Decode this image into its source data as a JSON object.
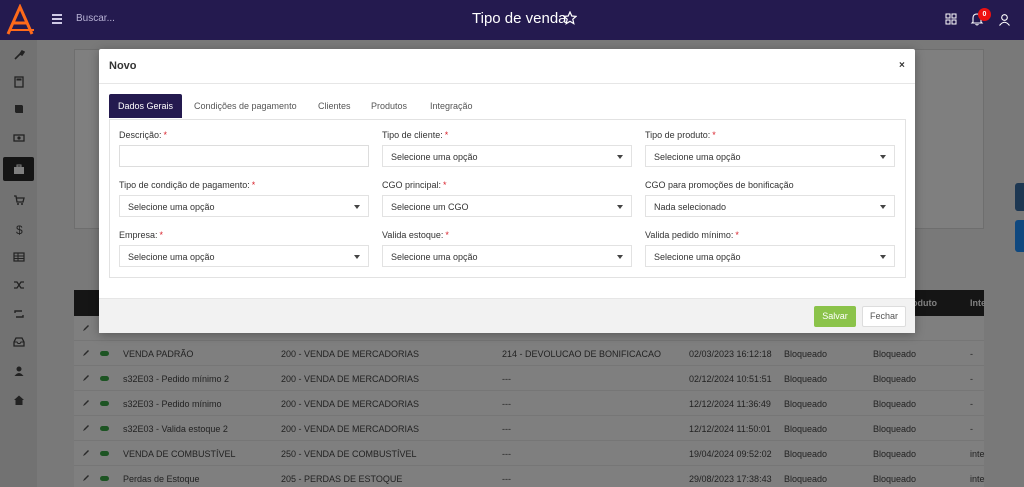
{
  "header": {
    "search_placeholder": "Buscar...",
    "title": "Tipo de venda",
    "notification_count": "0"
  },
  "sidebar": {
    "icons": [
      "wrench-icon",
      "calculator-icon",
      "book-icon",
      "money-icon",
      "briefcase-icon",
      "cart-icon",
      "dollar-icon",
      "table-icon",
      "shuffle-icon",
      "sync-icon",
      "inbox-icon",
      "user-icon",
      "home-icon"
    ]
  },
  "background": {
    "header_cells": [
      "oduto",
      "Inte"
    ],
    "rows": [
      {
        "name": "VENDA PADRÃO",
        "cfop": "200 - VENDA DE MERCADORIAS",
        "bonus": "214 - DEVOLUCAO DE BONIFICACAO",
        "date": "02/03/2023 16:12:18",
        "s1": "Bloqueado",
        "s2": "Bloqueado",
        "s3": "-"
      },
      {
        "name": "s32E03 - Pedido mínimo 2",
        "cfop": "200 - VENDA DE MERCADORIAS",
        "bonus": "---",
        "date": "02/12/2024 10:51:51",
        "s1": "Bloqueado",
        "s2": "Bloqueado",
        "s3": "-"
      },
      {
        "name": "s32E03 - Pedido mínimo",
        "cfop": "200 - VENDA DE MERCADORIAS",
        "bonus": "---",
        "date": "12/12/2024 11:36:49",
        "s1": "Bloqueado",
        "s2": "Bloqueado",
        "s3": "-"
      },
      {
        "name": "s32E03 - Valida estoque 2",
        "cfop": "200 - VENDA DE MERCADORIAS",
        "bonus": "---",
        "date": "12/12/2024 11:50:01",
        "s1": "Bloqueado",
        "s2": "Bloqueado",
        "s3": "-"
      },
      {
        "name": "VENDA DE COMBUSTÍVEL",
        "cfop": "250 - VENDA DE COMBUSTÍVEL",
        "bonus": "---",
        "date": "19/04/2024 09:52:02",
        "s1": "Bloqueado",
        "s2": "Bloqueado",
        "s3": "inte"
      },
      {
        "name": "Perdas de Estoque",
        "cfop": "205 - PERDAS DE ESTOQUE",
        "bonus": "---",
        "date": "29/08/2023 17:38:43",
        "s1": "Bloqueado",
        "s2": "Bloqueado",
        "s3": "inte"
      }
    ]
  },
  "modal": {
    "title": "Novo",
    "close": "×",
    "tabs": [
      "Dados Gerais",
      "Condições de pagamento",
      "Clientes",
      "Produtos",
      "Integração"
    ],
    "fields": {
      "descricao": {
        "label": "Descrição:",
        "value": ""
      },
      "tipo_cliente": {
        "label": "Tipo de cliente:",
        "value": "Selecione uma opção"
      },
      "tipo_produto": {
        "label": "Tipo de produto:",
        "value": "Selecione uma opção"
      },
      "tipo_condicao": {
        "label": "Tipo de condição de pagamento:",
        "value": "Selecione uma opção"
      },
      "cgo_principal": {
        "label": "CGO principal:",
        "value": "Selecione um CGO"
      },
      "cgo_bonificacao": {
        "label": "CGO para promoções de bonificação",
        "value": "Nada selecionado"
      },
      "empresa": {
        "label": "Empresa:",
        "value": "Selecione uma opção"
      },
      "valida_estoque": {
        "label": "Valida estoque:",
        "value": "Selecione uma opção"
      },
      "valida_pedido": {
        "label": "Valida pedido mínimo:",
        "value": "Selecione uma opção"
      }
    },
    "required_mark": "*",
    "save_label": "Salvar",
    "close_label": "Fechar"
  },
  "colors": {
    "topbar": "#241a4f",
    "accent": "#241a4f",
    "save": "#8bc34a",
    "required": "#d9232d"
  }
}
